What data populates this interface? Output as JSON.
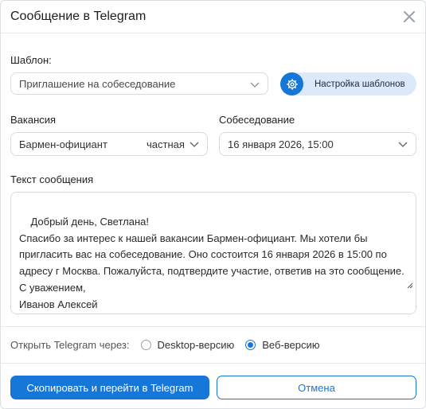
{
  "dialog": {
    "title": "Сообщение в Telegram"
  },
  "template": {
    "label": "Шаблон:",
    "selected": "Приглашение на собеседование",
    "settings_button": "Настройка шаблонов"
  },
  "vacancy": {
    "label": "Вакансия",
    "selected": "Бармен-официант",
    "type": "частная"
  },
  "interview": {
    "label": "Собеседование",
    "selected": "16 января 2026, 15:00"
  },
  "message": {
    "label": "Текст сообщения",
    "text": "Добрый день, Светлана!\nСпасибо за интерес к нашей вакансии Бармен-официант. Мы хотели бы пригласить вас на собеседование. Оно состоится 16 января 2026 в 15:00 по адресу г Москва. Пожалуйста, подтвердите участие, ответив на это сообщение.\nС уважением,\nИванов Алексей"
  },
  "open_via": {
    "label": "Открыть Telegram через:",
    "options": [
      {
        "label": "Desktop-версию",
        "checked": false
      },
      {
        "label": "Веб-версию",
        "checked": true
      }
    ]
  },
  "actions": {
    "primary": "Скопировать и перейти в Telegram",
    "cancel": "Отмена"
  },
  "colors": {
    "accent": "#1677d8",
    "accent_light": "#dbe9fb"
  },
  "icons": {
    "close": "close-icon",
    "chevron": "chevron-down-icon",
    "settings": "gear-icon",
    "resize": "resize-handle-icon"
  }
}
